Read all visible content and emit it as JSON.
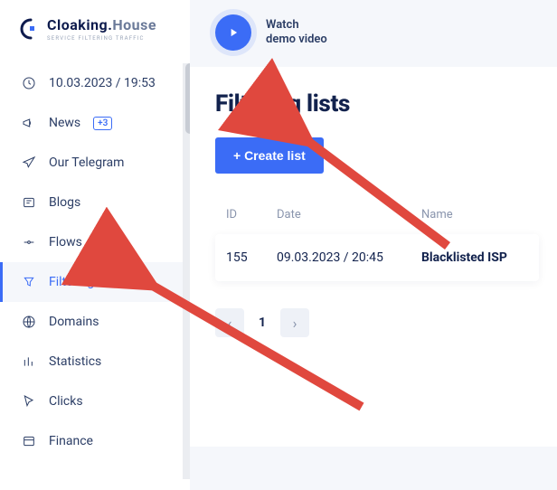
{
  "brand": {
    "name_left": "Cloaking.",
    "name_right": "House",
    "tagline": "SERVICE FILTERING TRAFFIC"
  },
  "header": {
    "watch_line1": "Watch",
    "watch_line2": "demo video"
  },
  "datetime": "10.03.2023 / 19:53",
  "sidebar": {
    "items": [
      {
        "label": "News",
        "badge": "+3"
      },
      {
        "label": "Our Telegram"
      },
      {
        "label": "Blogs"
      },
      {
        "label": "Flows"
      },
      {
        "label": "Filtering lists"
      },
      {
        "label": "Domains"
      },
      {
        "label": "Statistics"
      },
      {
        "label": "Clicks"
      },
      {
        "label": "Finance"
      }
    ]
  },
  "page": {
    "title": "Filtering lists",
    "create_label": "+ Create list"
  },
  "table": {
    "headers": {
      "id": "ID",
      "date": "Date",
      "name": "Name"
    },
    "rows": [
      {
        "id": "155",
        "date": "09.03.2023 / 20:45",
        "name": "Blacklisted ISP"
      }
    ]
  },
  "pager": {
    "prev": "‹",
    "current": "1",
    "next": "›"
  },
  "colors": {
    "accent": "#3b6cf6"
  }
}
